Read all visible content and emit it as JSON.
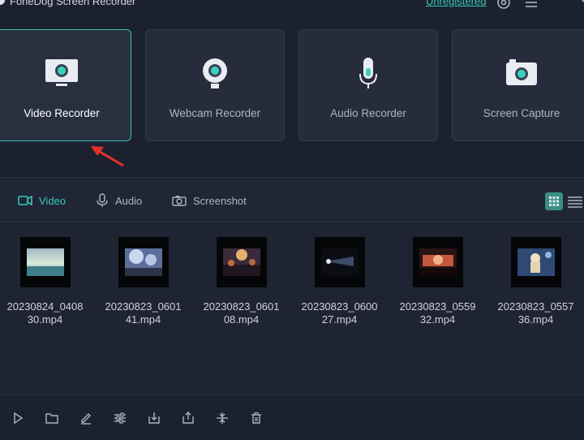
{
  "window": {
    "title": "FoneDog Screen Recorder",
    "registration_link": "Unregistered"
  },
  "modes": [
    {
      "label": "Video Recorder",
      "icon": "monitor-icon",
      "active": true
    },
    {
      "label": "Webcam Recorder",
      "icon": "webcam-icon",
      "active": false
    },
    {
      "label": "Audio Recorder",
      "icon": "microphone-icon",
      "active": false
    },
    {
      "label": "Screen Capture",
      "icon": "camera-icon",
      "active": false
    }
  ],
  "tabs": [
    {
      "label": "Video",
      "icon": "video-icon",
      "active": true
    },
    {
      "label": "Audio",
      "icon": "microphone-icon",
      "active": false
    },
    {
      "label": "Screenshot",
      "icon": "camera-icon",
      "active": false
    }
  ],
  "files": [
    {
      "name": "20230824_040830.mp4",
      "line1": "20230824_0408",
      "line2": "30.mp4"
    },
    {
      "name": "20230823_060141.mp4",
      "line1": "20230823_0601",
      "line2": "41.mp4"
    },
    {
      "name": "20230823_060108.mp4",
      "line1": "20230823_0601",
      "line2": "08.mp4"
    },
    {
      "name": "20230823_060027.mp4",
      "line1": "20230823_0600",
      "line2": "27.mp4"
    },
    {
      "name": "20230823_055932.mp4",
      "line1": "20230823_0559",
      "line2": "32.mp4"
    },
    {
      "name": "20230823_055736.mp4",
      "line1": "20230823_0557",
      "line2": "36.mp4"
    }
  ],
  "toolbar": [
    "play-icon",
    "folder-icon",
    "edit-icon",
    "settings-sliders-icon",
    "import-icon",
    "share-icon",
    "split-icon",
    "trash-icon"
  ],
  "colors": {
    "accent": "#39cbb7",
    "background": "#1f2433",
    "card": "#262c3b",
    "annotation_arrow": "#e8302a"
  }
}
